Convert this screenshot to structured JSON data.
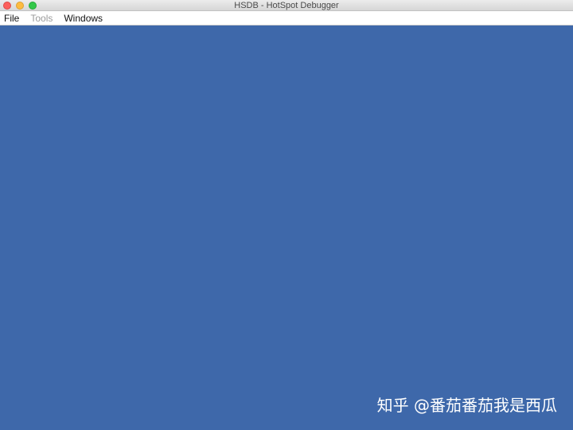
{
  "window": {
    "title": "HSDB - HotSpot Debugger",
    "background_color": "#3E68AA"
  },
  "menubar": {
    "items": [
      {
        "label": "File",
        "enabled": true
      },
      {
        "label": "Tools",
        "enabled": false
      },
      {
        "label": "Windows",
        "enabled": true
      }
    ]
  },
  "watermark": {
    "text": "知乎 @番茄番茄我是西瓜"
  }
}
